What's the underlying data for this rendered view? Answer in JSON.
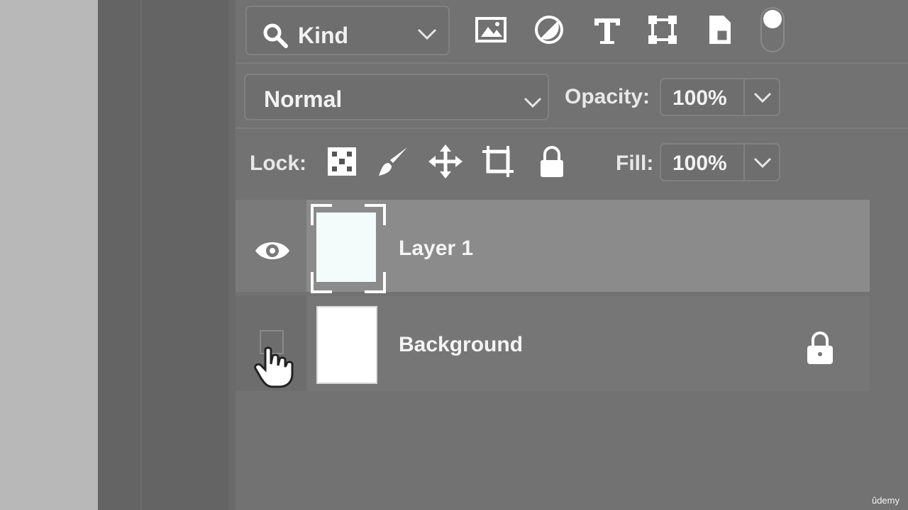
{
  "filter_bar": {
    "kind_label": "Kind",
    "filter_icons": [
      "image-filter-icon",
      "adjustment-filter-icon",
      "type-filter-icon",
      "shape-filter-icon",
      "smart-object-filter-icon"
    ]
  },
  "blend": {
    "mode": "Normal",
    "opacity_label": "Opacity:",
    "opacity_value": "100%"
  },
  "lock": {
    "label": "Lock:",
    "icons": [
      "lock-transparent-pixels-icon",
      "lock-image-pixels-icon",
      "lock-position-icon",
      "lock-artboard-icon",
      "lock-all-icon"
    ],
    "fill_label": "Fill:",
    "fill_value": "100%"
  },
  "layers": [
    {
      "name": "Layer 1",
      "visible": true,
      "selected": true,
      "locked": false
    },
    {
      "name": "Background",
      "visible": false,
      "selected": false,
      "locked": true
    }
  ],
  "branding": {
    "udemy": "ûdemy"
  },
  "colors": {
    "panel": "#727272",
    "selected_row": "#8b8b8b",
    "text": "#f2f2f2"
  }
}
